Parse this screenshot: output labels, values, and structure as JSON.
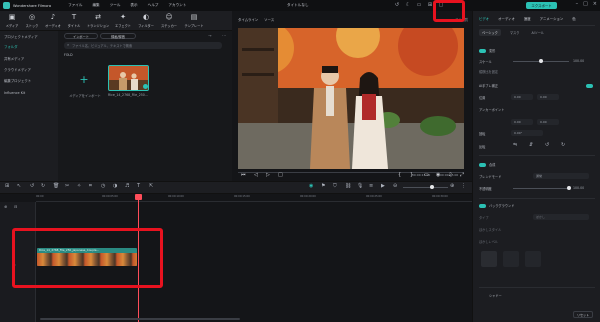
{
  "app": {
    "name": "Wondershare Filmora",
    "document_title": "タイトルなし",
    "menu": [
      "ファイル",
      "編集",
      "ツール",
      "表示",
      "ヘルプ",
      "アカウント"
    ],
    "export_label": "エクスポート",
    "title_icons": [
      "undo-icon",
      "moon-icon",
      "layout-icon",
      "grid-icon",
      "window-icon"
    ]
  },
  "toolbar": {
    "items": [
      {
        "label": "メディア",
        "icon": "media-icon",
        "glyph": "▣"
      },
      {
        "label": "ストック",
        "icon": "stock-icon",
        "glyph": "◎"
      },
      {
        "label": "オーディオ",
        "icon": "audio-icon",
        "glyph": "♪"
      },
      {
        "label": "タイトル",
        "icon": "title-icon",
        "glyph": "T"
      },
      {
        "label": "トランジション",
        "icon": "transition-icon",
        "glyph": "⇄"
      },
      {
        "label": "エフェクト",
        "icon": "effect-icon",
        "glyph": "✦"
      },
      {
        "label": "フィルター",
        "icon": "filter-icon",
        "glyph": "◐"
      },
      {
        "label": "ステッカー",
        "icon": "sticker-icon",
        "glyph": "☺"
      },
      {
        "label": "テンプレート",
        "icon": "template-icon",
        "glyph": "▤"
      }
    ]
  },
  "sidebar": {
    "items": [
      {
        "label": "プロジェクトメディア",
        "active": false
      },
      {
        "label": "フォルダ",
        "active": true
      },
      {
        "label": "共有メディア",
        "active": false
      },
      {
        "label": "クラウドメディア",
        "active": false
      },
      {
        "label": "編集プロジェクト",
        "active": false
      },
      {
        "label": "Influence Kit",
        "active": false
      }
    ]
  },
  "media": {
    "import_label": "インポート",
    "record_label": "録画/録音",
    "search_placeholder": "ファイル名、ビジュアル、テキストで検索",
    "folder_label": "FOLD",
    "import_tile_label": "メディアをインポート",
    "clip_name": "Rice_14_2768_File_250..."
  },
  "preview": {
    "tabs": [
      "タイムライン",
      "ソース"
    ],
    "quality": "フル品質",
    "time_current": "00:00:15:00",
    "time_total": "00:00:15:00"
  },
  "properties": {
    "tabs": [
      {
        "label": "ビデオ",
        "active": true
      },
      {
        "label": "オーディオ",
        "active": false
      },
      {
        "label": "速度",
        "active": false
      },
      {
        "label": "アニメーション",
        "active": false
      },
      {
        "label": "色",
        "active": false
      }
    ],
    "subtabs": [
      {
        "label": "ベーシック",
        "active": true
      },
      {
        "label": "マスク",
        "active": false
      },
      {
        "label": "AIツール",
        "active": false
      }
    ],
    "section_transform": "変形",
    "scale_label": "スケール",
    "scale_value": "100.00",
    "scale_fraction": 0.5,
    "uniform_label": "縦横比を固定",
    "ai_label": "AI手ブレ補正",
    "position_label": "位置",
    "pos_x": "0.00",
    "pos_y": "0.00",
    "anchor_label": "アンカーポイント",
    "anchor_x": "0.00",
    "anchor_y": "0.00",
    "rotate_label": "回転",
    "rotate_value": "0.00°",
    "flip_label": "反転",
    "section_composite": "合成",
    "blend_label": "ブレンドモード",
    "blend_value": "通常",
    "opacity_label": "不透明度",
    "opacity_value": "100.00",
    "opacity_fraction": 1.0,
    "section_background": "バックグラウンド",
    "bg_type_label": "タイプ",
    "bg_type_value": "ぼかし",
    "bg_style_label": "ぼかしスタイル",
    "bg_level_label": "ぼかしレベル",
    "section_shadow": "シャドー",
    "reset_label": "リセット"
  },
  "timeline": {
    "ruler_ticks": [
      "00:00",
      "00:00:05:00",
      "00:00:10:00",
      "00:00:15:00",
      "00:00:20:00",
      "00:00:25:00",
      "00:00:30:00",
      "00:00:35:00"
    ],
    "clip_label": "Rice_14_2768_File_250_Japanese_Couple..."
  },
  "colors": {
    "accent": "#2bc1b4",
    "highlight": "#e8121f",
    "playhead": "#ff4d5a"
  }
}
